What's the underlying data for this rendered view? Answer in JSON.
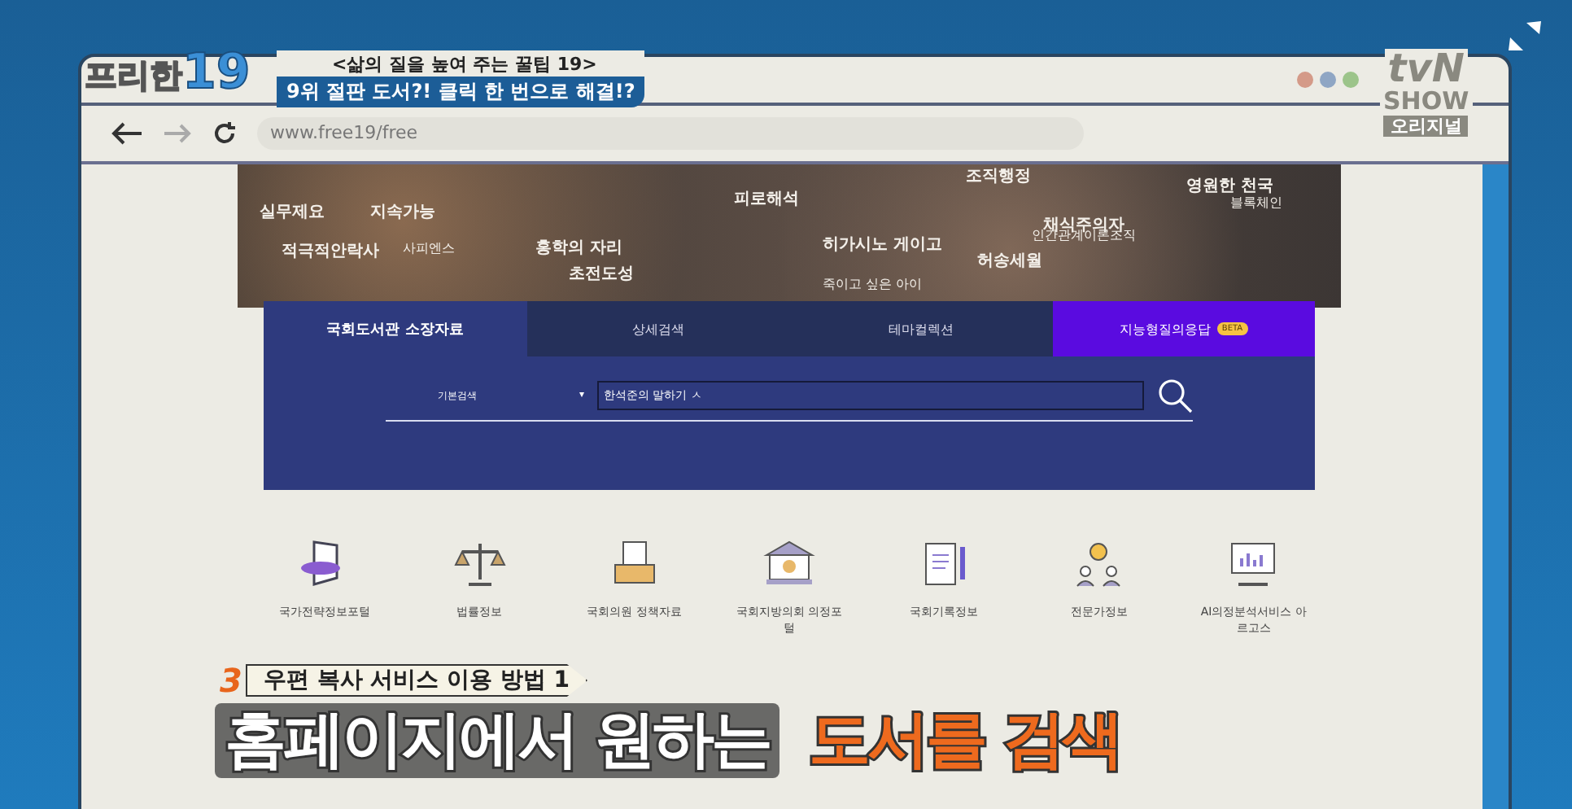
{
  "show_logo": {
    "title": "프리한",
    "number": "19"
  },
  "caption": {
    "subtitle": "<삶의 질을 높여 주는 꿀팁 19>",
    "headline": "9위 절판 도서?! 클릭 한 번으로 해결!?"
  },
  "channel_logo": {
    "brand": "tvN",
    "line_2": "SHOW",
    "line_3": "오리지널"
  },
  "window_dots": [
    {
      "color": "#d49a88"
    },
    {
      "color": "#8fa6c4"
    },
    {
      "color": "#9cc48a"
    }
  ],
  "address_bar": {
    "url": "www.free19/free"
  },
  "banner_keywords": [
    "실무제요",
    "지속가능",
    "피로해석",
    "조직행정",
    "영원한 천국",
    "블록체인",
    "채식주의자",
    "인간관계이론조직",
    "적극적안락사",
    "사피엔스",
    "홍학의 자리",
    "히가시노 게이고",
    "초전도성",
    "죽이고 싶은 아이",
    "허송세월"
  ],
  "tabs": [
    {
      "label": "국회도서관 소장자료",
      "selected": true,
      "kind": "plain"
    },
    {
      "label": "상세검색",
      "selected": false,
      "kind": "plain"
    },
    {
      "label": "테마컬렉션",
      "selected": false,
      "kind": "plain"
    },
    {
      "label": "지능형질의응답",
      "selected": false,
      "kind": "ai",
      "badge": "BETA"
    }
  ],
  "search": {
    "scope": "기본검색",
    "caret": "▾",
    "value": "한석준의 말하기 ㅅ"
  },
  "services": [
    {
      "label": "국가전략정보포털"
    },
    {
      "label": "법률정보"
    },
    {
      "label": "국회의원 정책자료"
    },
    {
      "label": "국회지방의회 의정포털"
    },
    {
      "label": "국회기록정보"
    },
    {
      "label": "전문가정보"
    },
    {
      "label": "AI의정분석서비스 아르고스"
    }
  ],
  "step_tag": {
    "number": "3",
    "label": "우편 복사 서비스 이용 방법 1"
  },
  "main_caption": {
    "text": "홈페이지에서 원하는",
    "highlight": "도서를 검색"
  }
}
